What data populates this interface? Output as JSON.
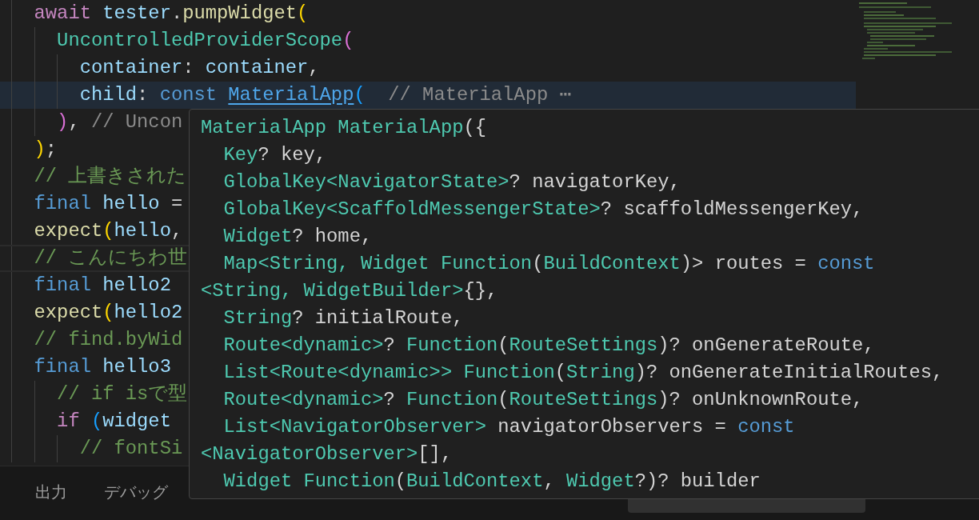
{
  "editor": {
    "lines": [
      {
        "current": false,
        "bordered": false,
        "tokens": [
          {
            "t": "  await",
            "kind": "control"
          },
          {
            "t": " tester",
            "kind": "var"
          },
          {
            "t": ".",
            "kind": "plain"
          },
          {
            "t": "pumpWidget",
            "kind": "func"
          },
          {
            "t": "(",
            "kind": "gold"
          }
        ]
      },
      {
        "current": false,
        "bordered": false,
        "tokens": [
          {
            "t": "    UncontrolledProviderScope",
            "kind": "class"
          },
          {
            "t": "(",
            "kind": "pink"
          }
        ]
      },
      {
        "current": false,
        "bordered": false,
        "tokens": [
          {
            "t": "      container",
            "kind": "var"
          },
          {
            "t": ": ",
            "kind": "plain"
          },
          {
            "t": "container",
            "kind": "var"
          },
          {
            "t": ",",
            "kind": "plain"
          }
        ]
      },
      {
        "current": true,
        "bordered": false,
        "tokens": [
          {
            "t": "      child",
            "kind": "var"
          },
          {
            "t": ": ",
            "kind": "plain"
          },
          {
            "t": "const ",
            "kind": "keyword"
          },
          {
            "t": "MaterialApp",
            "kind": "link"
          },
          {
            "t": "(",
            "kind": "blue"
          },
          {
            "t": "  // MaterialApp ⋯",
            "kind": "inlay"
          }
        ]
      },
      {
        "current": false,
        "bordered": false,
        "tokens": [
          {
            "t": "    )",
            "kind": "pink"
          },
          {
            "t": ", ",
            "kind": "plain"
          },
          {
            "t": "// Uncon",
            "kind": "inlay"
          }
        ]
      },
      {
        "current": false,
        "bordered": false,
        "tokens": [
          {
            "t": "  )",
            "kind": "gold"
          },
          {
            "t": ";",
            "kind": "plain"
          }
        ]
      },
      {
        "current": false,
        "bordered": false,
        "tokens": [
          {
            "t": "  // 上書きされた",
            "kind": "comment"
          }
        ]
      },
      {
        "current": false,
        "bordered": false,
        "tokens": [
          {
            "t": "  final",
            "kind": "keyword"
          },
          {
            "t": " hello",
            "kind": "var"
          },
          {
            "t": " =",
            "kind": "plain"
          }
        ]
      },
      {
        "current": false,
        "bordered": false,
        "tokens": [
          {
            "t": "  expect",
            "kind": "func"
          },
          {
            "t": "(",
            "kind": "gold"
          },
          {
            "t": "hello",
            "kind": "var"
          },
          {
            "t": ",",
            "kind": "plain"
          }
        ]
      },
      {
        "current": false,
        "bordered": true,
        "tokens": [
          {
            "t": "  // こんにちわ世",
            "kind": "comment"
          }
        ]
      },
      {
        "current": false,
        "bordered": false,
        "tokens": [
          {
            "t": "  final",
            "kind": "keyword"
          },
          {
            "t": " hello2",
            "kind": "var"
          }
        ]
      },
      {
        "current": false,
        "bordered": false,
        "tokens": [
          {
            "t": "  expect",
            "kind": "func"
          },
          {
            "t": "(",
            "kind": "gold"
          },
          {
            "t": "hello2",
            "kind": "var"
          }
        ]
      },
      {
        "current": false,
        "bordered": false,
        "tokens": [
          {
            "t": "  // find.byWid",
            "kind": "comment"
          }
        ]
      },
      {
        "current": false,
        "bordered": false,
        "tokens": [
          {
            "t": "  final",
            "kind": "keyword"
          },
          {
            "t": " hello3",
            "kind": "var"
          }
        ]
      },
      {
        "current": false,
        "bordered": false,
        "tokens": [
          {
            "t": "    // if isで型",
            "kind": "comment"
          }
        ]
      },
      {
        "current": false,
        "bordered": false,
        "tokens": [
          {
            "t": "    if",
            "kind": "control"
          },
          {
            "t": " (",
            "kind": "blue"
          },
          {
            "t": "widget",
            "kind": "var"
          }
        ]
      },
      {
        "current": false,
        "bordered": false,
        "tokens": [
          {
            "t": "      // fontSi",
            "kind": "comment"
          }
        ]
      }
    ]
  },
  "hover": {
    "lines": [
      {
        "tokens": [
          {
            "t": "MaterialApp MaterialApp",
            "kind": "class"
          },
          {
            "t": "({",
            "kind": "plain"
          }
        ]
      },
      {
        "tokens": [
          {
            "t": "  Key",
            "kind": "class"
          },
          {
            "t": "? key,",
            "kind": "plain"
          }
        ]
      },
      {
        "tokens": [
          {
            "t": "  GlobalKey<NavigatorState>",
            "kind": "class"
          },
          {
            "t": "? navigatorKey,",
            "kind": "plain"
          }
        ]
      },
      {
        "tokens": [
          {
            "t": "  GlobalKey<ScaffoldMessengerState>",
            "kind": "class"
          },
          {
            "t": "? scaffoldMessengerKey,",
            "kind": "plain"
          }
        ]
      },
      {
        "tokens": [
          {
            "t": "  Widget",
            "kind": "class"
          },
          {
            "t": "? home,",
            "kind": "plain"
          }
        ]
      },
      {
        "tokens": [
          {
            "t": "  Map<String, Widget Function",
            "kind": "class"
          },
          {
            "t": "(",
            "kind": "plain"
          },
          {
            "t": "BuildContext",
            "kind": "class"
          },
          {
            "t": ")> routes = ",
            "kind": "plain"
          },
          {
            "t": "const",
            "kind": "keyword"
          }
        ]
      },
      {
        "tokens": [
          {
            "t": "<String, WidgetBuilder>",
            "kind": "class"
          },
          {
            "t": "{},",
            "kind": "plain"
          }
        ]
      },
      {
        "tokens": [
          {
            "t": "  String",
            "kind": "class"
          },
          {
            "t": "? initialRoute,",
            "kind": "plain"
          }
        ]
      },
      {
        "tokens": [
          {
            "t": "  Route<dynamic>",
            "kind": "class"
          },
          {
            "t": "? ",
            "kind": "plain"
          },
          {
            "t": "Function",
            "kind": "class"
          },
          {
            "t": "(",
            "kind": "plain"
          },
          {
            "t": "RouteSettings",
            "kind": "class"
          },
          {
            "t": ")? onGenerateRoute,",
            "kind": "plain"
          }
        ]
      },
      {
        "tokens": [
          {
            "t": "  List<Route<dynamic>> Function",
            "kind": "class"
          },
          {
            "t": "(",
            "kind": "plain"
          },
          {
            "t": "String",
            "kind": "class"
          },
          {
            "t": ")? onGenerateInitialRoutes,",
            "kind": "plain"
          }
        ]
      },
      {
        "tokens": [
          {
            "t": "  Route<dynamic>",
            "kind": "class"
          },
          {
            "t": "? ",
            "kind": "plain"
          },
          {
            "t": "Function",
            "kind": "class"
          },
          {
            "t": "(",
            "kind": "plain"
          },
          {
            "t": "RouteSettings",
            "kind": "class"
          },
          {
            "t": ")? onUnknownRoute,",
            "kind": "plain"
          }
        ]
      },
      {
        "tokens": [
          {
            "t": "  List<NavigatorObserver>",
            "kind": "class"
          },
          {
            "t": " navigatorObservers = ",
            "kind": "plain"
          },
          {
            "t": "const",
            "kind": "keyword"
          }
        ]
      },
      {
        "tokens": [
          {
            "t": "<NavigatorObserver>",
            "kind": "class"
          },
          {
            "t": "[],",
            "kind": "plain"
          }
        ]
      },
      {
        "tokens": [
          {
            "t": "  Widget Function",
            "kind": "class"
          },
          {
            "t": "(",
            "kind": "plain"
          },
          {
            "t": "BuildContext",
            "kind": "class"
          },
          {
            "t": ", ",
            "kind": "plain"
          },
          {
            "t": "Widget",
            "kind": "class"
          },
          {
            "t": "?)? builder",
            "kind": "plain"
          }
        ]
      }
    ]
  },
  "panel": {
    "tabs": [
      {
        "label": "出力",
        "selected": false
      },
      {
        "label": "デバッグ",
        "selected": false
      }
    ]
  }
}
